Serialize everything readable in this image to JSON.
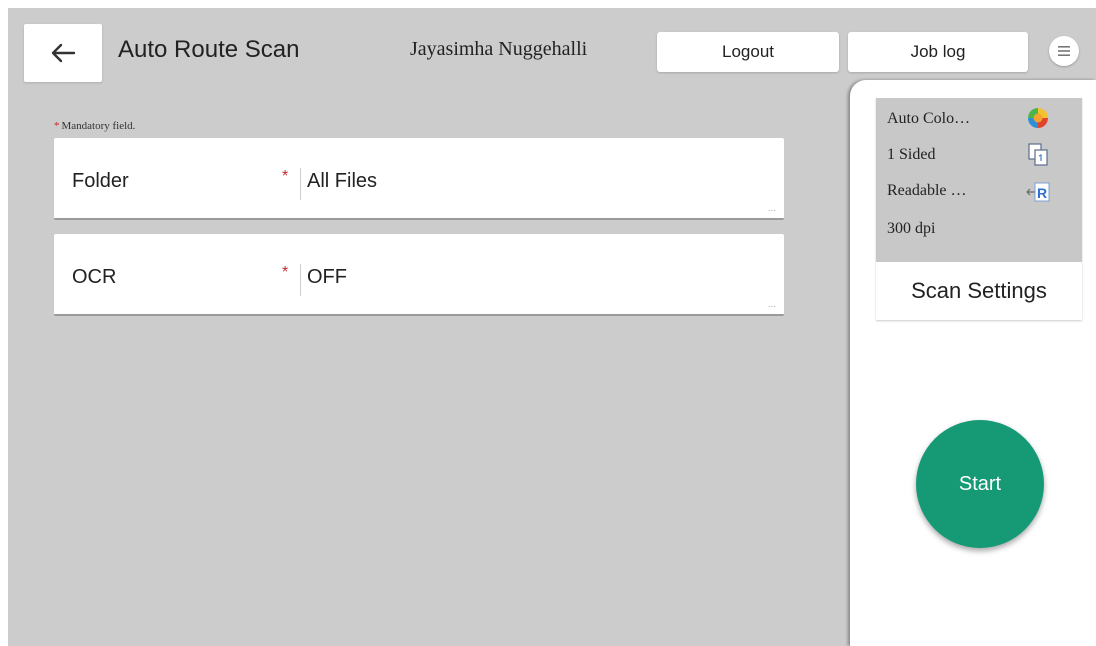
{
  "header": {
    "title": "Auto Route Scan",
    "user_name": "Jayasimha Nuggehalli",
    "logout_label": "Logout",
    "job_log_label": "Job log",
    "back_icon": "arrow-left-icon",
    "menu_icon": "hamburger-menu-icon"
  },
  "form": {
    "mandatory_star": "*",
    "mandatory_note": "Mandatory field.",
    "fields": [
      {
        "label": "Folder",
        "required_mark": "*",
        "value": "All Files",
        "more": "..."
      },
      {
        "label": "OCR",
        "required_mark": "*",
        "value": "OFF",
        "more": "..."
      }
    ]
  },
  "scan_panel": {
    "settings": [
      {
        "text": "Auto Colo…",
        "icon": "auto-color-icon"
      },
      {
        "text": "1 Sided",
        "icon": "one-sided-page-icon"
      },
      {
        "text": "Readable …",
        "icon": "readable-orientation-icon"
      },
      {
        "text": "300 dpi"
      }
    ],
    "scan_settings_label": "Scan Settings",
    "start_label": "Start"
  },
  "colors": {
    "background": "#cccccc",
    "panel": "#ffffff",
    "start_button": "#169a75",
    "required_star": "#c8282d"
  }
}
